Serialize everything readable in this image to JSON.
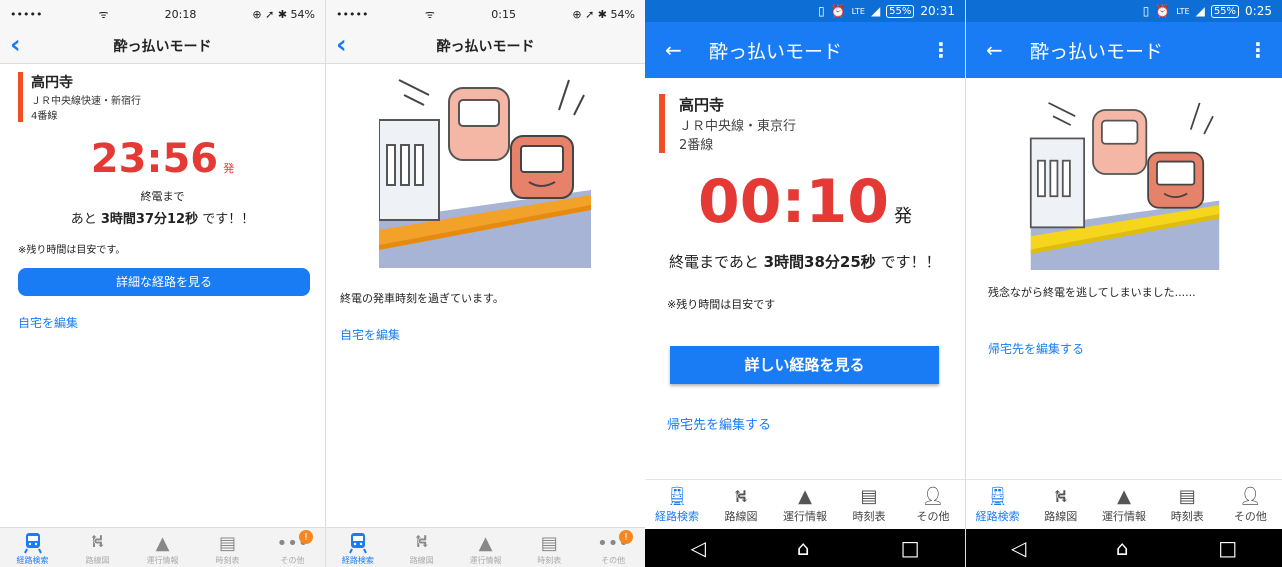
{
  "panel1": {
    "status": {
      "carrier": "•••••",
      "wifi": "ᯤ",
      "time": "20:18",
      "right": "⊕ ➚ ✱ 54%"
    },
    "nav_title": "酔っ払いモード",
    "station": "高円寺",
    "line": "ＪＲ中央線快速・新宿行",
    "platform": "4番線",
    "departure_time": "23:56",
    "departure_suffix": "発",
    "until_label": "終電まで",
    "remaining_prefix": "あと ",
    "remaining": "3時間37分12秒",
    "remaining_suffix": " です！！",
    "note": "※残り時間は目安です。",
    "route_button": "詳細な経路を見る",
    "edit_home": "自宅を編集",
    "tabs": [
      "経路検索",
      "路線図",
      "運行情報",
      "時刻表",
      "その他"
    ],
    "badge": "!"
  },
  "panel2": {
    "status": {
      "carrier": "•••••",
      "wifi": "ᯤ",
      "time": "0:15",
      "right": "⊕ ➚ ✱ 54%"
    },
    "nav_title": "酔っ払いモード",
    "message": "終電の発車時刻を過ぎています。",
    "edit_home": "自宅を編集",
    "tabs": [
      "経路検索",
      "路線図",
      "運行情報",
      "時刻表",
      "その他"
    ],
    "badge": "!"
  },
  "panel3": {
    "status": {
      "time": "20:31",
      "battery": "55%",
      "lte": "LTE"
    },
    "title": "酔っ払いモード",
    "station": "高円寺",
    "line": "ＪＲ中央線・東京行",
    "platform": "2番線",
    "departure_time": "00:10",
    "departure_suffix": "発",
    "remaining_prefix": "終電まであと ",
    "remaining": "3時間38分25秒",
    "remaining_suffix": " です！！",
    "note": "※残り時間は目安です",
    "route_button": "詳しい経路を見る",
    "edit_home": "帰宅先を編集する",
    "tabs": [
      "経路検索",
      "路線図",
      "運行情報",
      "時刻表",
      "その他"
    ]
  },
  "panel4": {
    "status": {
      "time": "0:25",
      "battery": "55%",
      "lte": "LTE"
    },
    "title": "酔っ払いモード",
    "message": "残念ながら終電を逃してしまいました......",
    "edit_home": "帰宅先を編集する",
    "tabs": [
      "経路検索",
      "路線図",
      "運行情報",
      "時刻表",
      "その他"
    ]
  },
  "colors": {
    "accent": "#1a7cf4",
    "time_red": "#e53935",
    "line_orange": "#f04e23"
  }
}
